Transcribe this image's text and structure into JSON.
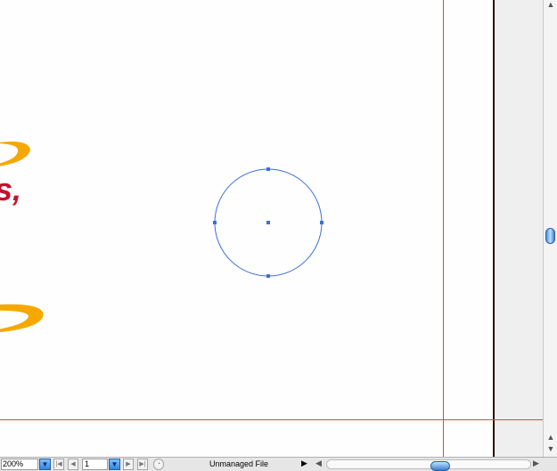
{
  "document": {
    "visible_text_fragment": "s,",
    "colors": {
      "text_red": "#c4122f",
      "swoosh_orange": "#f5a800",
      "guide_orange": "#c8561e",
      "selection_blue": "#3a6fd8"
    },
    "selected_object": "circle"
  },
  "statusbar": {
    "zoom_value": "200%",
    "page_value": "1",
    "file_status": "Unmanaged File"
  },
  "icons": {
    "zoom_dropdown": "chevron-down-icon",
    "first_page": "first-page-icon",
    "prev_page": "prev-page-icon",
    "page_dropdown": "chevron-down-icon",
    "next_page": "next-page-icon",
    "last_page": "last-page-icon",
    "status_menu": "clock-icon",
    "status_arrow": "triangle-right-icon"
  }
}
